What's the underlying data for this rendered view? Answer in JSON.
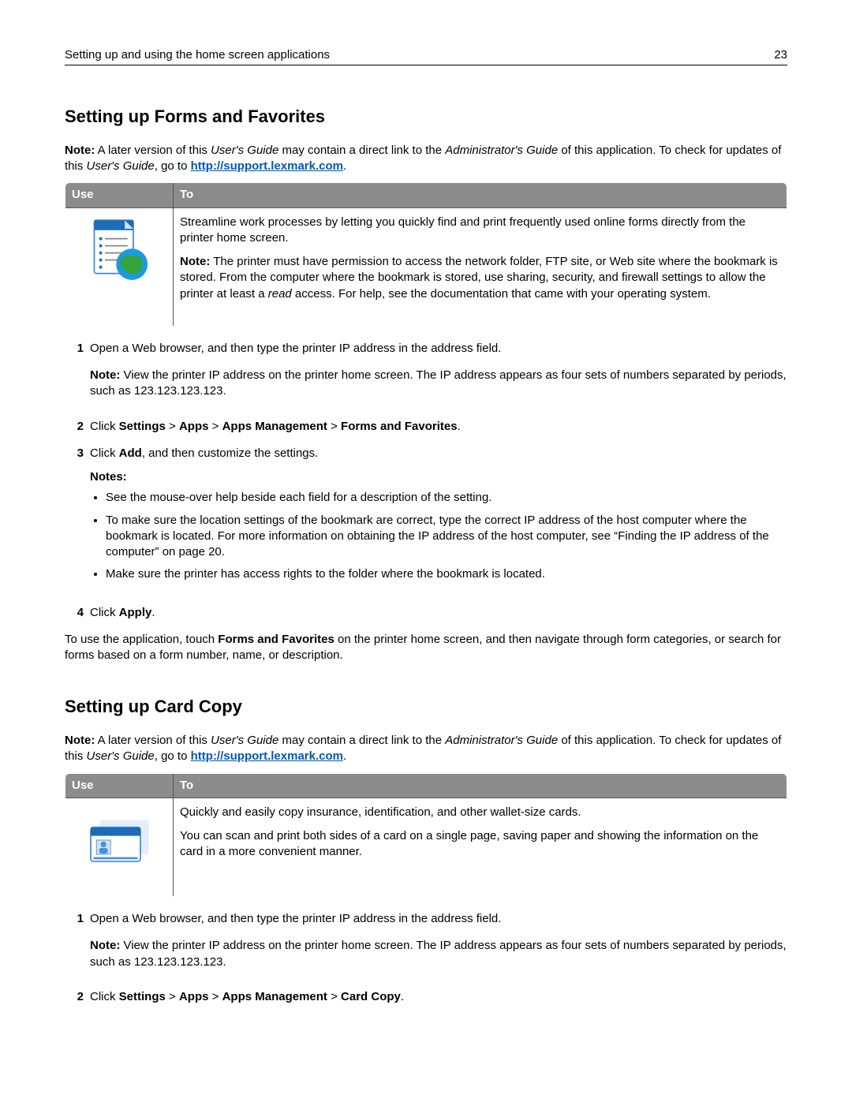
{
  "header": {
    "title": "Setting up and using the home screen applications",
    "page": "23"
  },
  "section1": {
    "heading": "Setting up Forms and Favorites",
    "noteLabel": "Note:",
    "noteA": " A later version of this ",
    "ug1": "User's Guide",
    "noteB": " may contain a direct link to the ",
    "ag": "Administrator's Guide",
    "noteC": " of this application. To check for updates of this ",
    "ug2": "User's Guide",
    "noteD": ", go to ",
    "url": "http://support.lexmark.com",
    "period": ".",
    "thUse": "Use",
    "thTo": "To",
    "tdPara1": "Streamline work processes by letting you quickly find and print frequently used online forms directly from the printer home screen.",
    "tdNoteLabel": "Note:",
    "tdNoteA": " The printer must have permission to access the network folder, FTP site, or Web site where the bookmark is stored. From the computer where the bookmark is stored, use sharing, security, and firewall settings to allow the printer at least a ",
    "tdRead": "read",
    "tdNoteB": " access. For help, see the documentation that came with your operating system.",
    "step1num": "1",
    "step1": "Open a Web browser, and then type the printer IP address in the address field.",
    "step1subLabel": "Note:",
    "step1sub": " View the printer IP address on the printer home screen. The IP address appears as four sets of numbers separated by periods, such as 123.123.123.123.",
    "step2num": "2",
    "step2a": "Click ",
    "step2settings": "Settings",
    "step2gt1": " > ",
    "step2apps": "Apps",
    "step2gt2": " > ",
    "step2mgmt": "Apps Management",
    "step2gt3": " > ",
    "step2ff": "Forms and Favorites",
    "step2end": ".",
    "step3num": "3",
    "step3a": "Click ",
    "step3add": "Add",
    "step3b": ", and then customize the settings.",
    "notesLabel": "Notes:",
    "bullet1": "See the mouse-over help beside each field for a description of the setting.",
    "bullet2": "To make sure the location settings of the bookmark are correct, type the correct IP address of the host computer where the bookmark is located. For more information on obtaining the IP address of the host computer, see “Finding the IP address of the computer” on page 20.",
    "bullet3": "Make sure the printer has access rights to the folder where the bookmark is located.",
    "step4num": "4",
    "step4a": "Click ",
    "step4apply": "Apply",
    "step4b": ".",
    "closingA": "To use the application, touch ",
    "closingFF": "Forms and Favorites",
    "closingB": " on the printer home screen, and then navigate through form categories, or search for forms based on a form number, name, or description."
  },
  "section2": {
    "heading": "Setting up Card Copy",
    "noteLabel": "Note:",
    "noteA": " A later version of this ",
    "ug1": "User's Guide",
    "noteB": " may contain a direct link to the ",
    "ag": "Administrator's Guide",
    "noteC": " of this application. To check for updates of this ",
    "ug2": "User's Guide",
    "noteD": ", go to ",
    "url": "http://support.lexmark.com",
    "period": ".",
    "thUse": "Use",
    "thTo": "To",
    "tdPara1": "Quickly and easily copy insurance, identification, and other wallet-size cards.",
    "tdPara2": "You can scan and print both sides of a card on a single page, saving paper and showing the information on the card in a more convenient manner.",
    "step1num": "1",
    "step1": "Open a Web browser, and then type the printer IP address in the address field.",
    "step1subLabel": "Note:",
    "step1sub": " View the printer IP address on the printer home screen. The IP address appears as four sets of numbers separated by periods, such as 123.123.123.123.",
    "step2num": "2",
    "step2a": "Click ",
    "step2settings": "Settings",
    "step2gt1": " > ",
    "step2apps": "Apps",
    "step2gt2": " > ",
    "step2mgmt": "Apps Management",
    "step2gt3": " > ",
    "step2cc": "Card Copy",
    "step2end": "."
  }
}
